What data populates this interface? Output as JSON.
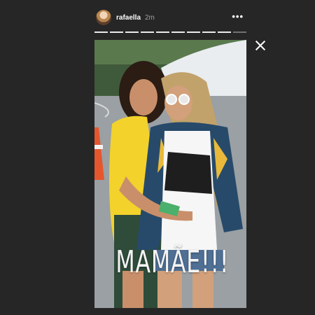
{
  "header": {
    "username": "rafaella",
    "time": "2m",
    "more_icon": "more-horizontal-icon",
    "segments": 10,
    "active_segment": 9
  },
  "story": {
    "caption": "MAMÃE!!!"
  },
  "close_icon": "close-icon"
}
